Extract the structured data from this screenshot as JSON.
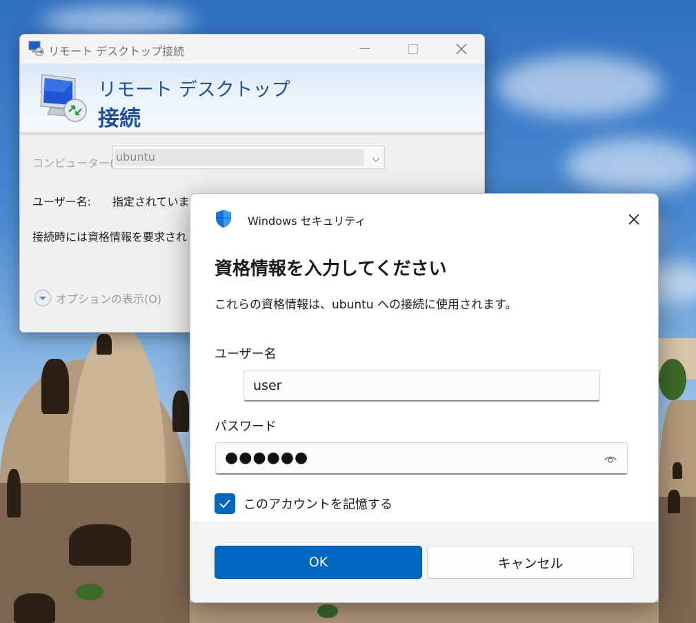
{
  "rdc_window": {
    "title": "リモート デスクトップ接続",
    "banner_line1": "リモート デスクトップ",
    "banner_line2": "接続",
    "computer_label": "コンピューター(C):",
    "computer_value": "ubuntu",
    "username_label": "ユーザー名:",
    "username_value": "指定されていませ",
    "info_text": "接続時には資格情報を要求され",
    "options_label": "オプションの表示(O)"
  },
  "security_dialog": {
    "app_name": "Windows セキュリティ",
    "heading": "資格情報を入力してください",
    "description": "これらの資格情報は、ubuntu への接続に使用されます。",
    "username_label": "ユーザー名",
    "username_value": "user",
    "password_label": "パスワード",
    "password_mask": "●●●●●●",
    "remember_label": "このアカウントを記憶する",
    "remember_checked": true,
    "ok_label": "OK",
    "cancel_label": "キャンセル"
  },
  "colors": {
    "accent": "#0067c0",
    "rdc_banner_text": "#1d4f9a"
  },
  "icons": {
    "rdc_title": "remote-desktop-icon",
    "rdc_banner": "monitor-connect-icon",
    "security": "shield-icon",
    "options": "chevron-down-circle-icon",
    "password_reveal": "eye-icon",
    "checkbox": "checkmark-icon"
  }
}
